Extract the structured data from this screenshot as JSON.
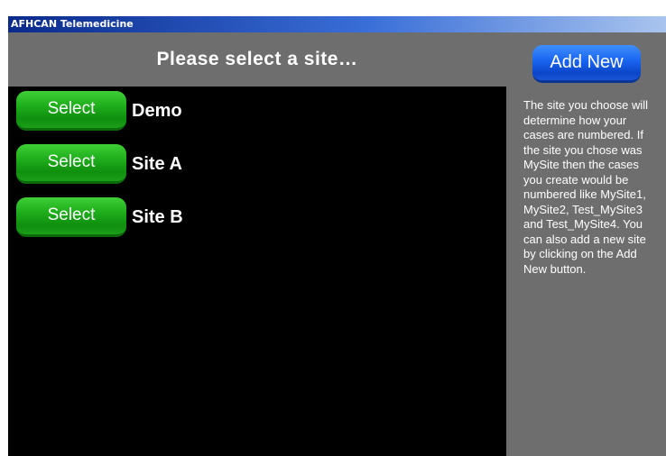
{
  "window": {
    "title": "AFHCAN Telemedicine"
  },
  "main": {
    "heading": "Please select a site…",
    "sites": [
      {
        "button_label": "Select",
        "name": "Demo"
      },
      {
        "button_label": "Select",
        "name": "Site A"
      },
      {
        "button_label": "Select",
        "name": "Site B"
      }
    ]
  },
  "side": {
    "add_new_label": "Add New",
    "help_text": "The site you choose will determine how your cases are numbered.  If the site you chose was MySite then the cases you create would be numbered like MySite1, MySite2, Test_MySite3 and Test_MySite4.  You can also add a new site by clicking on the Add New button."
  },
  "colors": {
    "panel_gray": "#6e6e6e",
    "list_background": "#000000",
    "select_green": "#1fae1c",
    "add_blue": "#1a64f0",
    "title_blue": "#0a2a8c"
  }
}
